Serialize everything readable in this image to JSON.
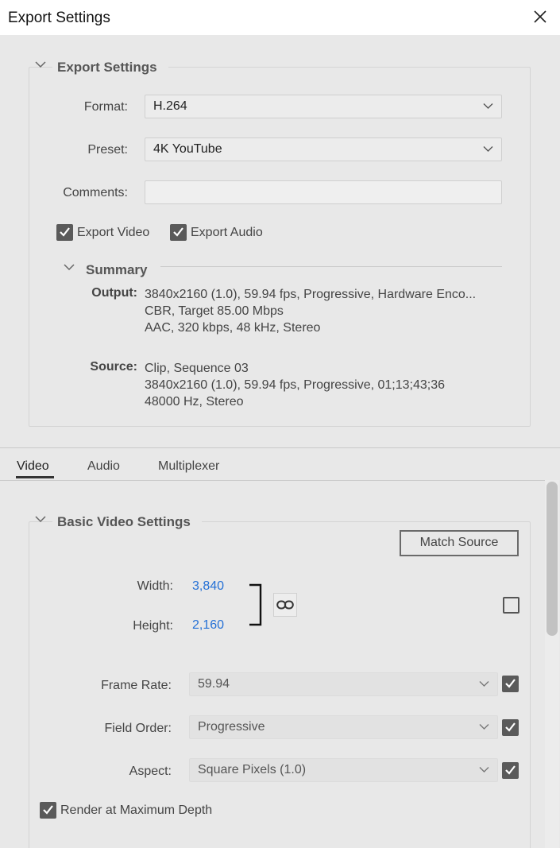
{
  "window": {
    "title": "Export Settings"
  },
  "export_settings": {
    "section_title": "Export Settings",
    "format": {
      "label": "Format:",
      "value": "H.264"
    },
    "preset": {
      "label": "Preset:",
      "value": "4K YouTube"
    },
    "comments": {
      "label": "Comments:",
      "value": "",
      "placeholder": ""
    },
    "export_video": {
      "label": "Export Video",
      "checked": true
    },
    "export_audio": {
      "label": "Export Audio",
      "checked": true
    }
  },
  "summary": {
    "title": "Summary",
    "output_label": "Output:",
    "output_lines": [
      "3840x2160 (1.0), 59.94 fps, Progressive, Hardware Enco...",
      "CBR, Target 85.00 Mbps",
      "AAC, 320 kbps, 48 kHz, Stereo"
    ],
    "source_label": "Source:",
    "source_lines": [
      "Clip, Sequence 03",
      "3840x2160 (1.0), 59.94 fps, Progressive, 01;13;43;36",
      "48000 Hz, Stereo"
    ]
  },
  "tabs": [
    {
      "label": "Video",
      "active": true
    },
    {
      "label": "Audio",
      "active": false
    },
    {
      "label": "Multiplexer",
      "active": false
    }
  ],
  "basic_video": {
    "section_title": "Basic Video Settings",
    "match_source_label": "Match Source",
    "width": {
      "label": "Width:",
      "value": "3,840"
    },
    "height": {
      "label": "Height:",
      "value": "2,160"
    },
    "frame_rate": {
      "label": "Frame Rate:",
      "value": "59.94",
      "checked": true
    },
    "field_order": {
      "label": "Field Order:",
      "value": "Progressive",
      "checked": true
    },
    "aspect": {
      "label": "Aspect:",
      "value": "Square Pixels (1.0)",
      "checked": true
    },
    "render_max_depth": {
      "label": "Render at Maximum Depth",
      "checked": true
    }
  },
  "icons": {
    "close": "close-icon",
    "chevron": "chevron-down-icon",
    "check": "checkmark-icon",
    "link": "link-icon"
  },
  "colors": {
    "accent_link": "#2470d6",
    "checkbox_fill": "#5a5a5a"
  }
}
